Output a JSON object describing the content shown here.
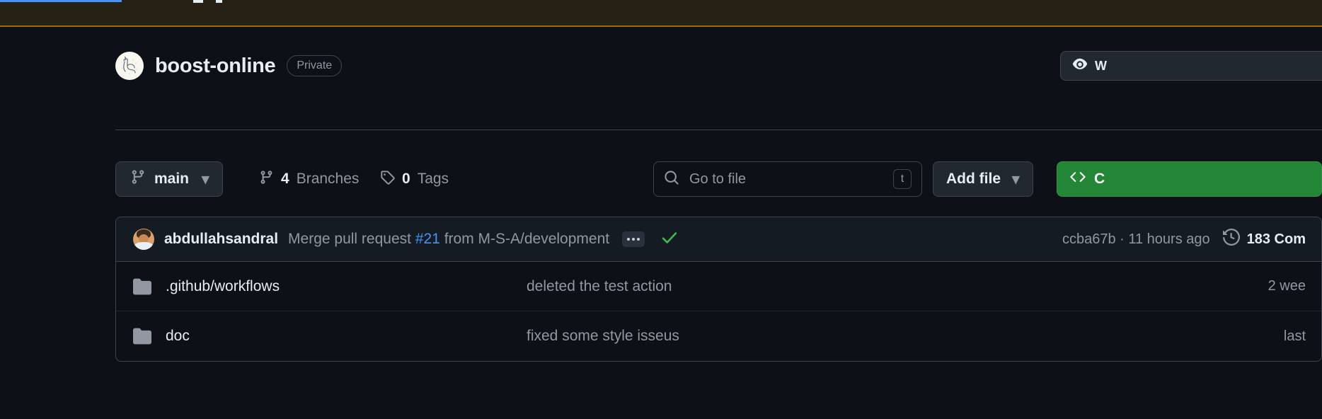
{
  "banner": {
    "accent_color": "#9e6a03",
    "background_color": "#272115",
    "link_color": "#4493f8"
  },
  "repo": {
    "name": "boost-online",
    "visibility": "Private",
    "avatar_icon": "camel-avatar-icon",
    "watch_label": "W",
    "watch_icon": "eye-icon"
  },
  "toolbar": {
    "branch_name": "main",
    "branch_icon": "git-branch-icon",
    "branch_chevron": "▾",
    "branches_count": "4",
    "branches_label": "Branches",
    "branches_icon": "git-branch-icon",
    "tags_count": "0",
    "tags_label": "Tags",
    "tags_icon": "tag-icon",
    "search_placeholder": "Go to file",
    "search_icon": "search-icon",
    "search_kbd": "t",
    "add_file_label": "Add file",
    "add_file_chevron": "▾",
    "code_label": "C",
    "code_icon": "code-brackets-icon",
    "code_color": "#238636"
  },
  "commit": {
    "author": "abdullahsandral",
    "avatar_icon": "user-avatar",
    "message_prefix": "Merge pull request ",
    "issue_ref": "#21",
    "message_suffix": " from M-S-A/development",
    "expand_icon": "ellipsis-icon",
    "status_icon": "check-icon",
    "status_color": "#3fb950",
    "sha": "ccba67b",
    "separator": "·",
    "relative_time": "11 hours ago",
    "commits_count": "183",
    "commits_label": "Com",
    "history_icon": "history-icon"
  },
  "files": [
    {
      "name": ".github/workflows",
      "icon": "folder-icon",
      "message": "deleted the test action",
      "age": "2 wee"
    },
    {
      "name": "doc",
      "icon": "folder-icon",
      "message": "fixed some style isseus",
      "age": "last "
    }
  ]
}
